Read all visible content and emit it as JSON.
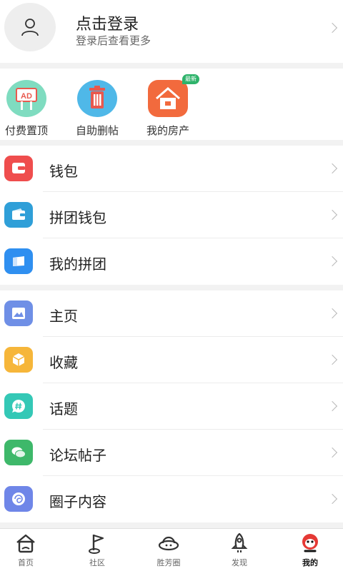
{
  "header": {
    "title": "点击登录",
    "subtitle": "登录后查看更多"
  },
  "quick": [
    {
      "label": "付费置顶",
      "icon": "ad-billboard-icon",
      "icon_text": "AD"
    },
    {
      "label": "自助删帖",
      "icon": "trash-can-icon"
    },
    {
      "label": "我的房产",
      "icon": "house-icon",
      "badge": "最新"
    }
  ],
  "group1": [
    {
      "label": "钱包",
      "icon": "wallet-icon",
      "color": "#ef4d4d"
    },
    {
      "label": "拼团钱包",
      "icon": "group-wallet-icon",
      "color": "#2f9fd8"
    },
    {
      "label": "我的拼团",
      "icon": "group-card-icon",
      "color": "#2f8ff0"
    }
  ],
  "group2": [
    {
      "label": "主页",
      "icon": "image-icon",
      "color": "#6f8fe6"
    },
    {
      "label": "收藏",
      "icon": "box-icon",
      "color": "#f6b63a"
    },
    {
      "label": "话题",
      "icon": "hashtag-icon",
      "color": "#34c8b6"
    },
    {
      "label": "论坛帖子",
      "icon": "chat-bubbles-icon",
      "color": "#3eb86a"
    },
    {
      "label": "圈子内容",
      "icon": "circle-swirl-icon",
      "color": "#6f86e8"
    }
  ],
  "tabs": [
    {
      "label": "首页",
      "icon": "home-icon"
    },
    {
      "label": "社区",
      "icon": "flag-icon"
    },
    {
      "label": "胜芳圈",
      "icon": "ufo-icon"
    },
    {
      "label": "发现",
      "icon": "rocket-icon"
    },
    {
      "label": "我的",
      "icon": "mascot-icon",
      "active": true
    }
  ]
}
